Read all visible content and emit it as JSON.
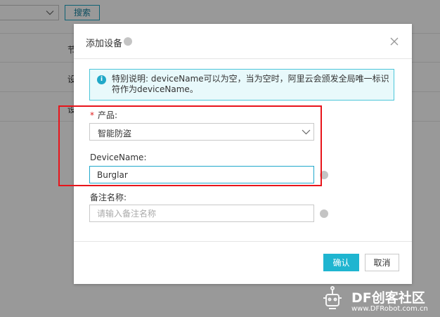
{
  "background": {
    "search_button": "搜索",
    "rows": [
      "节",
      "设",
      "设"
    ]
  },
  "dialog": {
    "title": "添加设备",
    "notice": "特别说明: deviceName可以为空，当为空时，阿里云会颁发全局唯一标识符作为deviceName。",
    "product_label": "产品:",
    "required_mark": "*",
    "product_value": "智能防盗",
    "device_name_label": "DeviceName:",
    "device_name_value": "Burglar",
    "remark_label": "备注名称:",
    "remark_placeholder": "请输入备注名称",
    "confirm": "确认",
    "cancel": "取消"
  },
  "watermark": {
    "name": "DF创客社区",
    "url": "www.DFRobot.com.cn"
  },
  "colors": {
    "accent": "#1fb5d0",
    "annotation": "#e8141b",
    "notice_bg": "#e8f9fb"
  }
}
